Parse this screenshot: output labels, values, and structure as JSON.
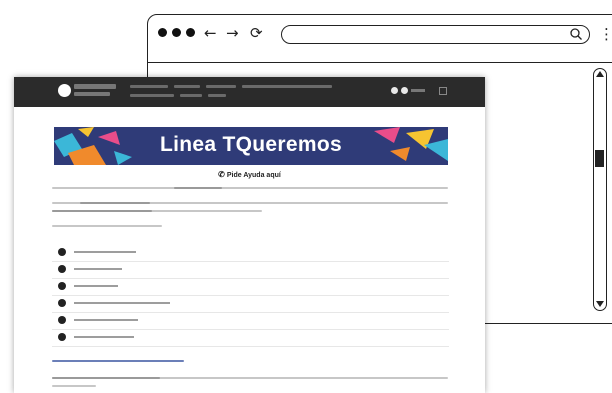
{
  "browser": {
    "nav": {
      "back": "←",
      "forward": "→",
      "reload": "⟳",
      "menu": "⋮"
    },
    "icons": {
      "search": "search-icon"
    }
  },
  "page": {
    "banner_title": "Linea TQueremos",
    "phone_text": "Pide Ayuda aquí",
    "colors": {
      "topbar": "#2b2b2b",
      "banner_bg": "#2f3b78",
      "accent_pink": "#e94d8a",
      "accent_orange": "#f08a2c",
      "accent_yellow": "#f6c431",
      "accent_cyan": "#3bb7d8"
    }
  }
}
